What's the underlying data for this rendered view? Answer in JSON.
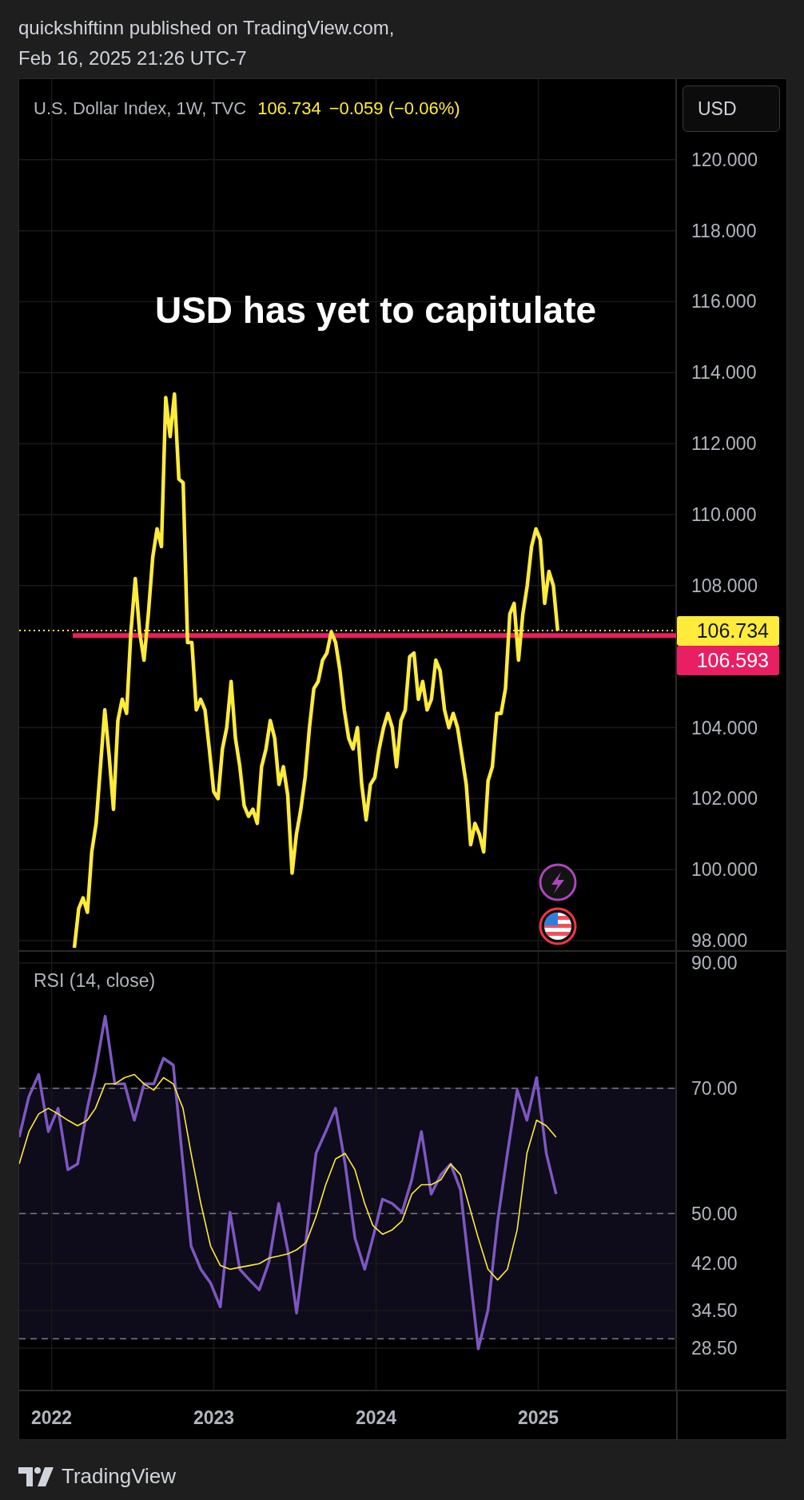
{
  "header": {
    "line_1": "quickshiftinn published on TradingView.com,",
    "line_2": "Feb 16, 2025 21:26 UTC-7"
  },
  "legend": {
    "symbol": "U.S. Dollar Index, 1W, TVC",
    "price": "106.734",
    "change": "−0.059 (−0.06%)"
  },
  "currency_button": "USD",
  "price_chart": {
    "headline": "USD has yet to capitulate",
    "chart_data": {
      "type": "line",
      "grid": true,
      "ylim": [
        97.73,
        122.27
      ],
      "ref_lines": [
        {
          "axis": "y",
          "value": 106.734,
          "color": "#ffeb3b"
        },
        {
          "axis": "y",
          "value": 106.593,
          "color": "#e91e63"
        }
      ],
      "categories": [
        null,
        null,
        null,
        null,
        null,
        null,
        null,
        null,
        null,
        null,
        null,
        null,
        null,
        null,
        null,
        null,
        null,
        null,
        null,
        null,
        null,
        null,
        null,
        null,
        null,
        null,
        null,
        null,
        null,
        null,
        null,
        null,
        null,
        null,
        null,
        null,
        null,
        null,
        null,
        null,
        null,
        null,
        null,
        null,
        null,
        null,
        null,
        null,
        null,
        null,
        null,
        null,
        null,
        null,
        null,
        null,
        null,
        null,
        null,
        null,
        null,
        null,
        null,
        null,
        null,
        null,
        null,
        null,
        null,
        null,
        null,
        null,
        null,
        null,
        null,
        null,
        null,
        null,
        null,
        null,
        null,
        null,
        null,
        null,
        null,
        null,
        null,
        null,
        null,
        null,
        null,
        null,
        null,
        null,
        null,
        null,
        null,
        null,
        null,
        null,
        null,
        null,
        null,
        null,
        null,
        null,
        null,
        null,
        null,
        null,
        null,
        null
      ],
      "series": [
        {
          "color": "#ffeb3b",
          "values": [
            97.8,
            98.9,
            99.2,
            98.8,
            100.5,
            101.3,
            102.9,
            104.5,
            103.2,
            101.7,
            104.2,
            104.8,
            104.4,
            106.7,
            108.2,
            106.7,
            105.9,
            107.2,
            108.8,
            109.6,
            109.1,
            113.3,
            112.2,
            113.4,
            111.0,
            110.9,
            106.4,
            106.4,
            104.5,
            104.8,
            104.5,
            103.4,
            102.2,
            102.0,
            103.4,
            104.0,
            105.3,
            103.7,
            102.9,
            101.8,
            101.5,
            101.7,
            101.3,
            102.9,
            103.4,
            104.2,
            103.7,
            102.4,
            102.9,
            102.1,
            99.9,
            101.0,
            101.7,
            102.6,
            104.0,
            105.1,
            105.3,
            105.9,
            106.1,
            106.7,
            106.4,
            105.6,
            104.5,
            103.7,
            103.4,
            104.0,
            102.4,
            101.4,
            102.4,
            102.6,
            103.4,
            104.0,
            104.4,
            104.0,
            102.9,
            104.2,
            104.5,
            106.0,
            106.1,
            104.8,
            105.3,
            104.5,
            104.8,
            105.9,
            105.6,
            104.5,
            104.0,
            104.4,
            104.0,
            103.2,
            102.4,
            100.7,
            101.3,
            101.0,
            100.5,
            102.5,
            102.9,
            104.4,
            104.4,
            105.1,
            107.2,
            107.5,
            105.9,
            107.2,
            108.0,
            109.1,
            109.6,
            109.3,
            107.5,
            108.4,
            108.0,
            106.73
          ]
        }
      ],
      "yticks": [
        {
          "value": 98,
          "label": "98.000"
        },
        {
          "value": 100,
          "label": "100.000"
        },
        {
          "value": 102,
          "label": "102.000"
        },
        {
          "value": 104,
          "label": "104.000"
        },
        {
          "value": 108,
          "label": "108.000"
        },
        {
          "value": 110,
          "label": "110.000"
        },
        {
          "value": 112,
          "label": "112.000"
        },
        {
          "value": 114,
          "label": "114.000"
        },
        {
          "value": 116,
          "label": "116.000"
        },
        {
          "value": 118,
          "label": "118.000"
        },
        {
          "value": 120,
          "label": "120.000"
        }
      ]
    }
  },
  "price_labels": [
    {
      "text": "106.734",
      "color": "#ffeb3b"
    },
    {
      "text": "106.593",
      "color": "#e91e63"
    }
  ],
  "rsi": {
    "chart_data": {
      "type": "line",
      "title": "RSI (14, close)",
      "grid": true,
      "xlim": [
        2021.8,
        2026.53
      ],
      "ylim": [
        21.87,
        91.79
      ],
      "bands": [
        {
          "axis": "y",
          "from": 30,
          "to": 70,
          "color": "#0e0b1a"
        }
      ],
      "x": [
        2021.8,
        2021.86,
        2021.92,
        2021.98,
        2022.04,
        2022.1,
        2022.16,
        2022.22,
        2022.27,
        2022.33,
        2022.39,
        2022.45,
        2022.51,
        2022.57,
        2022.63,
        2022.69,
        2022.75,
        2022.81,
        2022.86,
        2022.92,
        2022.98,
        2023.04,
        2023.1,
        2023.16,
        2023.22,
        2023.28,
        2023.34,
        2023.4,
        2023.46,
        2023.51,
        2023.57,
        2023.63,
        2023.69,
        2023.75,
        2023.81,
        2023.87,
        2023.93,
        2023.98,
        2024.04,
        2024.1,
        2024.16,
        2024.22,
        2024.28,
        2024.34,
        2024.4,
        2024.46,
        2024.52,
        2024.57,
        2024.63,
        2024.69,
        2024.75,
        2024.81,
        2024.87,
        2024.93,
        2024.99,
        2025.05,
        2025.11
      ],
      "series": [
        {
          "color": "#7e57c2",
          "values": [
            62.2,
            68.7,
            72.2,
            63.1,
            66.8,
            57.0,
            57.9,
            66.8,
            72.7,
            81.5,
            70.7,
            70.7,
            64.9,
            70.7,
            70.7,
            74.8,
            73.7,
            57.9,
            44.8,
            41.1,
            38.9,
            35.1,
            50.2,
            41.1,
            39.4,
            37.8,
            42.3,
            51.6,
            43.6,
            34.1,
            46.1,
            59.6,
            63.1,
            66.8,
            57.9,
            46.1,
            41.1,
            46.1,
            52.3,
            51.6,
            50.2,
            55.4,
            63.1,
            53.1,
            56.2,
            57.9,
            53.8,
            42.3,
            28.4,
            34.6,
            48.8,
            59.6,
            69.7,
            64.9,
            71.7,
            59.6,
            53.1
          ]
        },
        {
          "color": "#ffeb3b",
          "values": [
            57.9,
            63.1,
            65.9,
            66.8,
            65.9,
            64.9,
            64.0,
            64.9,
            66.8,
            70.7,
            70.7,
            71.7,
            72.2,
            70.7,
            69.7,
            71.7,
            70.7,
            66.8,
            59.6,
            51.6,
            44.8,
            41.7,
            41.1,
            41.4,
            41.7,
            42.0,
            42.9,
            43.2,
            43.6,
            44.2,
            45.4,
            49.5,
            54.6,
            58.7,
            59.6,
            57.0,
            51.6,
            48.1,
            46.7,
            47.4,
            48.8,
            53.1,
            54.6,
            54.6,
            55.4,
            57.9,
            56.2,
            51.6,
            46.1,
            41.1,
            39.4,
            41.1,
            47.4,
            59.6,
            64.9,
            64.0,
            62.2
          ]
        }
      ],
      "yticks": [
        {
          "value": 90,
          "label": "90.00"
        },
        {
          "value": 70,
          "label": "70.00"
        },
        {
          "value": 50,
          "label": "50.00"
        },
        {
          "value": 42,
          "label": "42.00"
        },
        {
          "value": 34.5,
          "label": "34.50"
        },
        {
          "value": 28.5,
          "label": "28.50"
        }
      ],
      "xticks": [
        {
          "value": 2022,
          "label": "2022"
        },
        {
          "value": 2023,
          "label": "2023"
        },
        {
          "value": 2024,
          "label": "2024"
        },
        {
          "value": 2025,
          "label": "2025"
        }
      ]
    }
  },
  "footer": {
    "brand": "TradingView"
  }
}
